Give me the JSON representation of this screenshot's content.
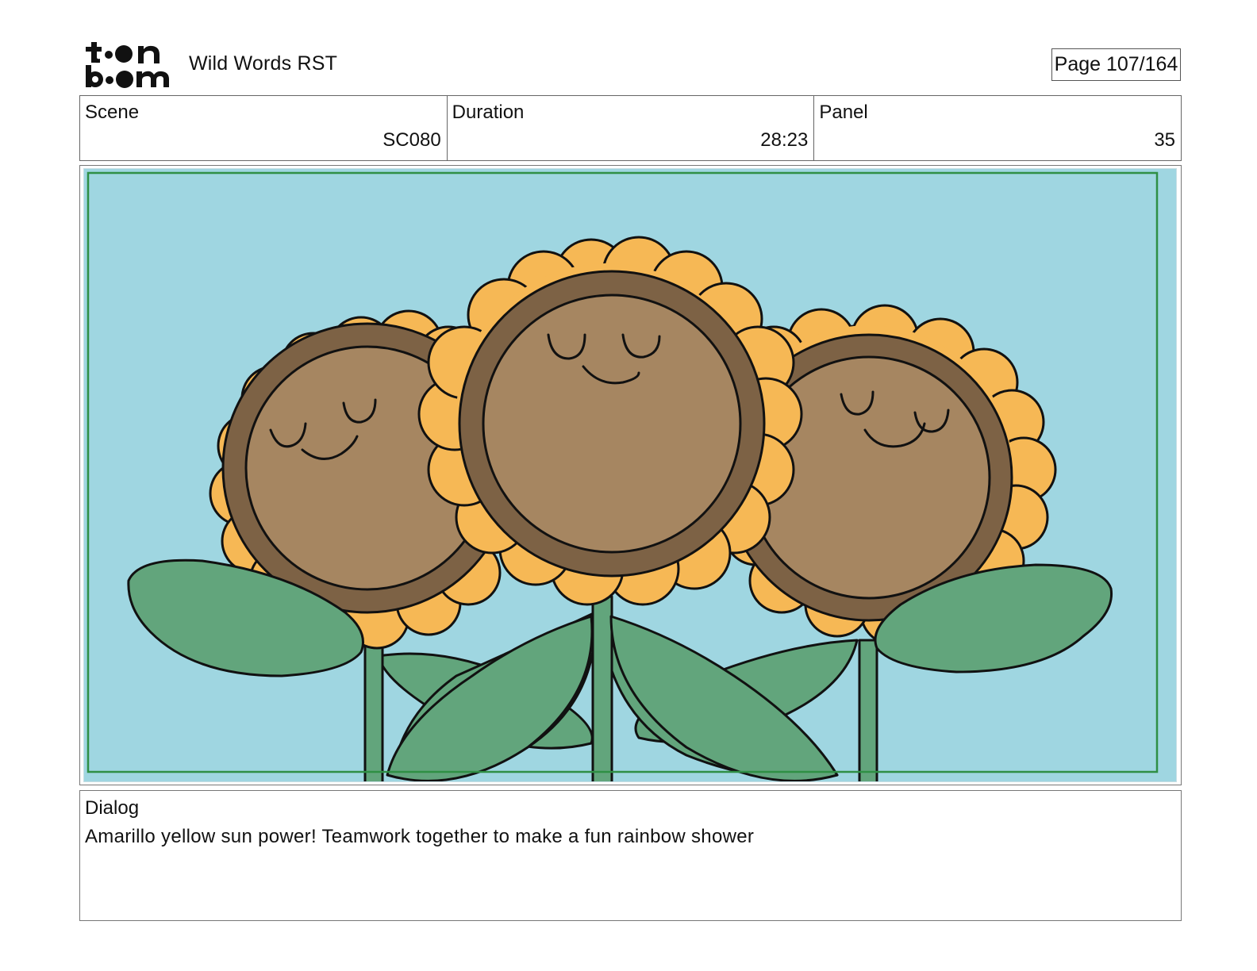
{
  "header": {
    "logo_text": "toon boom",
    "project_title": "Wild Words RST",
    "page_indicator": "Page 107/164"
  },
  "info": {
    "scene_label": "Scene",
    "scene_value": "SC080",
    "duration_label": "Duration",
    "duration_value": "28:23",
    "panel_label": "Panel",
    "panel_value": "35"
  },
  "panel_image": {
    "background_color": "#9fd6e1",
    "petal_color": "#f6b855",
    "face_color": "#a68661",
    "ring_color": "#7d6245",
    "leaf_color": "#62a57c"
  },
  "dialog": {
    "label": "Dialog",
    "text": "Amarillo yellow sun power! Teamwork together to make a fun rainbow shower"
  }
}
